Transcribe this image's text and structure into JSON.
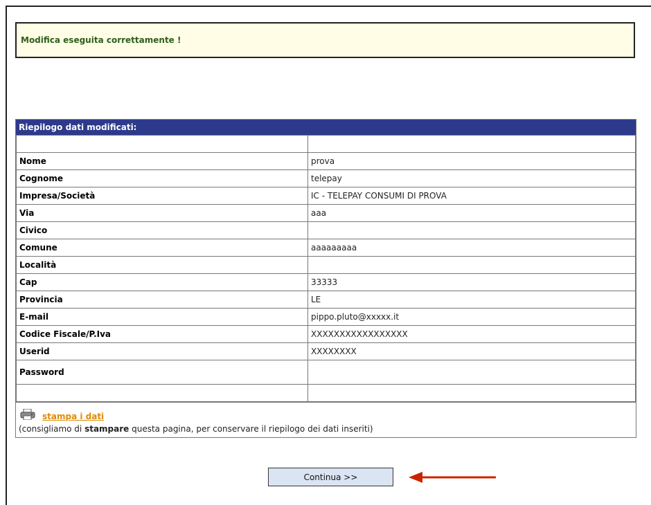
{
  "status": {
    "message": "Modifica eseguita correttamente !"
  },
  "summary": {
    "header": "Riepilogo dati modificati:",
    "rows": [
      {
        "label": "",
        "value": ""
      },
      {
        "label": "Nome",
        "value": "prova"
      },
      {
        "label": "Cognome",
        "value": "telepay"
      },
      {
        "label": "Impresa/Società",
        "value": "IC - TELEPAY CONSUMI DI PROVA"
      },
      {
        "label": "Via",
        "value": "aaa"
      },
      {
        "label": "Civico",
        "value": ""
      },
      {
        "label": "Comune",
        "value": "aaaaaaaaa"
      },
      {
        "label": "Località",
        "value": ""
      },
      {
        "label": "Cap",
        "value": "33333"
      },
      {
        "label": "Provincia",
        "value": "LE"
      },
      {
        "label": "E-mail",
        "value": "pippo.pluto@xxxxx.it"
      },
      {
        "label": "Codice Fiscale/P.Iva",
        "value": "XXXXXXXXXXXXXXXXX"
      },
      {
        "label": "Userid",
        "value": "XXXXXXXX"
      },
      {
        "label": "Password",
        "value": ""
      },
      {
        "label": "",
        "value": ""
      }
    ]
  },
  "print": {
    "icon": "printer-icon",
    "link_label": "stampa i dati",
    "note_prefix": "(consigliamo di ",
    "note_bold": "stampare",
    "note_suffix": " questa pagina, per conservare il riepilogo dei dati inseriti)"
  },
  "continue_label": "Continua >>",
  "colors": {
    "header_bg": "#2d3a8c",
    "success_bg": "#fffde6",
    "success_text": "#2e5e1a",
    "link": "#e08a00",
    "arrow": "#cc2200",
    "button_bg": "#dbe4f3"
  }
}
